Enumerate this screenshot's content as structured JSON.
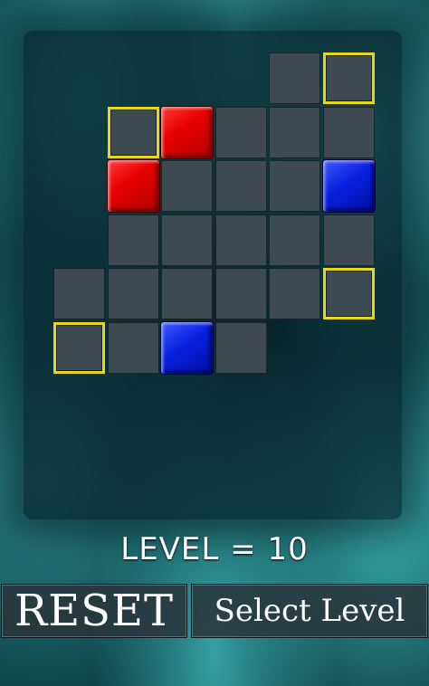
{
  "level": {
    "label": "LEVEL = 10"
  },
  "buttons": {
    "reset": "RESET",
    "select_level": "Select Level"
  },
  "colors": {
    "red_block": "#e80000",
    "blue_block": "#0a1fe0",
    "target_outline": "#e8d619",
    "cell": "#3e4a52"
  },
  "board": {
    "columns": 6,
    "rows": 6,
    "cells": [
      {
        "row": 0,
        "col": 4,
        "kind": "empty"
      },
      {
        "row": 0,
        "col": 5,
        "kind": "target"
      },
      {
        "row": 1,
        "col": 1,
        "kind": "target"
      },
      {
        "row": 1,
        "col": 2,
        "kind": "red"
      },
      {
        "row": 1,
        "col": 3,
        "kind": "empty"
      },
      {
        "row": 1,
        "col": 4,
        "kind": "empty"
      },
      {
        "row": 1,
        "col": 5,
        "kind": "empty"
      },
      {
        "row": 2,
        "col": 1,
        "kind": "red"
      },
      {
        "row": 2,
        "col": 2,
        "kind": "empty"
      },
      {
        "row": 2,
        "col": 3,
        "kind": "empty"
      },
      {
        "row": 2,
        "col": 4,
        "kind": "empty"
      },
      {
        "row": 2,
        "col": 5,
        "kind": "blue"
      },
      {
        "row": 3,
        "col": 1,
        "kind": "empty"
      },
      {
        "row": 3,
        "col": 2,
        "kind": "empty"
      },
      {
        "row": 3,
        "col": 3,
        "kind": "empty"
      },
      {
        "row": 3,
        "col": 4,
        "kind": "empty"
      },
      {
        "row": 3,
        "col": 5,
        "kind": "empty"
      },
      {
        "row": 4,
        "col": 0,
        "kind": "empty"
      },
      {
        "row": 4,
        "col": 1,
        "kind": "empty"
      },
      {
        "row": 4,
        "col": 2,
        "kind": "empty"
      },
      {
        "row": 4,
        "col": 3,
        "kind": "empty"
      },
      {
        "row": 4,
        "col": 4,
        "kind": "empty"
      },
      {
        "row": 4,
        "col": 5,
        "kind": "target"
      },
      {
        "row": 5,
        "col": 0,
        "kind": "target"
      },
      {
        "row": 5,
        "col": 1,
        "kind": "empty"
      },
      {
        "row": 5,
        "col": 2,
        "kind": "blue"
      },
      {
        "row": 5,
        "col": 3,
        "kind": "empty"
      }
    ]
  }
}
